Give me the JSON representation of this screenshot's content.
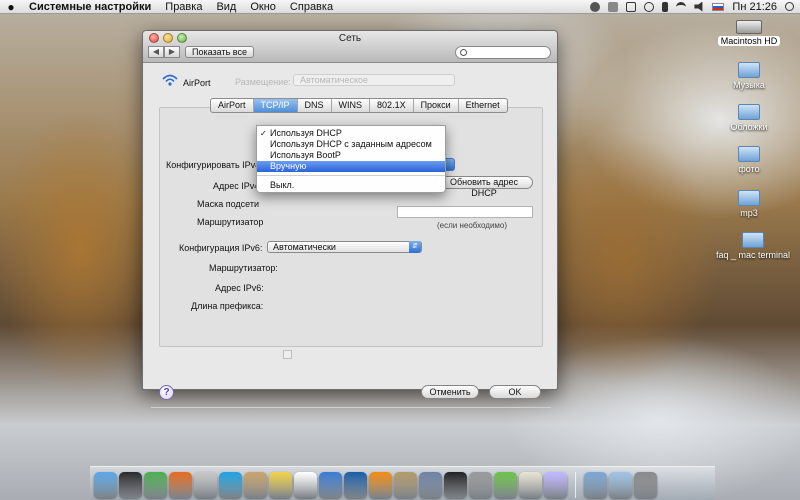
{
  "menubar": {
    "apple": "",
    "app_name": "Системные настройки",
    "items": [
      "Правка",
      "Вид",
      "Окно",
      "Справка"
    ],
    "clock": "Пн 21:26"
  },
  "desktop_icons": [
    {
      "label": "Macintosh HD"
    },
    {
      "label": "Музыка"
    },
    {
      "label": "Обложки"
    },
    {
      "label": "фото"
    },
    {
      "label": "mp3"
    },
    {
      "label": "faq _ mac terminal"
    }
  ],
  "window": {
    "title": "Сеть",
    "show_all": "Показать все",
    "search_placeholder": "",
    "airport_label": "AirPort",
    "ghost_location": "Размещение:",
    "ghost_location_value": "Автоматическое",
    "tabs": [
      "AirPort",
      "TCP/IP",
      "DNS",
      "WINS",
      "802.1X",
      "Прокси",
      "Ethernet"
    ],
    "active_tab": "TCP/IP",
    "labels": {
      "ipv4_config": "Конфигурировать IPv4",
      "ipv4_address": "Адрес IPv4",
      "subnet_mask": "Маска подсети",
      "router": "Маршрутизатор",
      "ipv6_config": "Конфигурация IPv6:",
      "router6": "Маршрутизатор:",
      "ipv6_address": "Адрес IPv6:",
      "prefix_length": "Длина префикса:"
    },
    "ipv6_select_value": "Автоматически",
    "renew_dhcp": "Обновить адрес DHCP",
    "if_needed": "(если необходимо)",
    "cancel": "Отменить",
    "ok": "OK",
    "help": "?"
  },
  "dropdown": {
    "items": [
      {
        "label": "Используя DHCP",
        "checked": true
      },
      {
        "label": "Используя DHCP с заданным адресом"
      },
      {
        "label": "Используя BootP"
      },
      {
        "label": "Вручную",
        "highlighted": true
      },
      {
        "label": "Выкл."
      }
    ]
  },
  "dock": {
    "colors": [
      "#5aa7e6",
      "#2a2a2a",
      "#4caf50",
      "#e86a1f",
      "#c7c7c7",
      "#1fa3e3",
      "#c9a36a",
      "#f2d24b",
      "#ffffff",
      "#3a7bd5",
      "#1a5ea8",
      "#f28c13",
      "#b39a6a",
      "#6f83a8",
      "#222222",
      "#9a9a9a",
      "#6cc24a",
      "#e8e4d2",
      "#c0b8ff",
      "#7aa7d6",
      "#9ec3e6",
      "#8a8a8a"
    ]
  }
}
